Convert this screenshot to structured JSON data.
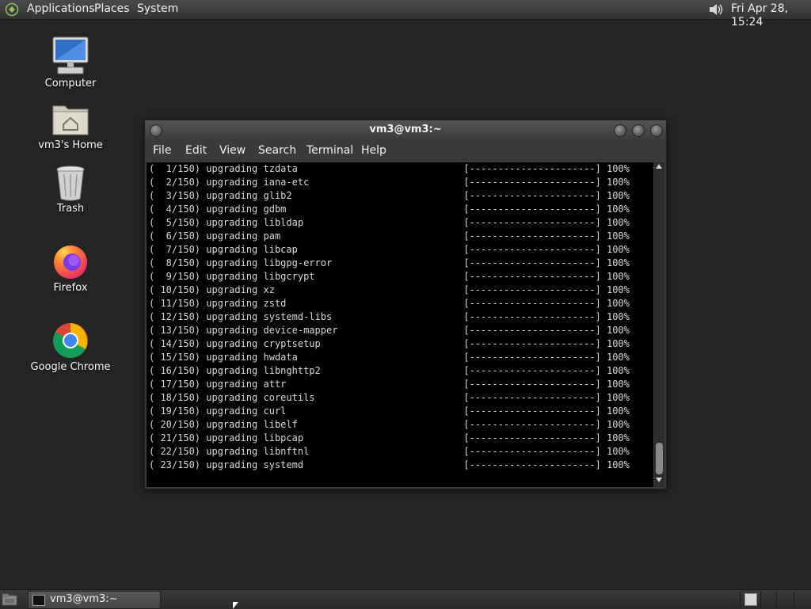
{
  "top_panel": {
    "menus": [
      "Applications",
      "Places",
      "System"
    ],
    "clock": "Fri Apr 28, 15:24"
  },
  "desktop_icons": [
    {
      "label": "Computer",
      "icon": "computer-icon"
    },
    {
      "label": "vm3's Home",
      "icon": "home-folder-icon"
    },
    {
      "label": "Trash",
      "icon": "trash-icon"
    },
    {
      "label": "Firefox",
      "icon": "firefox-icon"
    },
    {
      "label": "Google Chrome",
      "icon": "chrome-icon"
    }
  ],
  "terminal": {
    "title": "vm3@vm3:~",
    "menu": [
      "File",
      "Edit",
      "View",
      "Search",
      "Terminal",
      "Help"
    ],
    "lines": [
      "(  1/150) upgrading tzdata                             [----------------------] 100%",
      "(  2/150) upgrading iana-etc                           [----------------------] 100%",
      "(  3/150) upgrading glib2                              [----------------------] 100%",
      "(  4/150) upgrading gdbm                               [----------------------] 100%",
      "(  5/150) upgrading libldap                            [----------------------] 100%",
      "(  6/150) upgrading pam                                [----------------------] 100%",
      "(  7/150) upgrading libcap                             [----------------------] 100%",
      "(  8/150) upgrading libgpg-error                       [----------------------] 100%",
      "(  9/150) upgrading libgcrypt                          [----------------------] 100%",
      "( 10/150) upgrading xz                                 [----------------------] 100%",
      "( 11/150) upgrading zstd                               [----------------------] 100%",
      "( 12/150) upgrading systemd-libs                       [----------------------] 100%",
      "( 13/150) upgrading device-mapper                      [----------------------] 100%",
      "( 14/150) upgrading cryptsetup                         [----------------------] 100%",
      "( 15/150) upgrading hwdata                             [----------------------] 100%",
      "( 16/150) upgrading libnghttp2                         [----------------------] 100%",
      "( 17/150) upgrading attr                               [----------------------] 100%",
      "( 18/150) upgrading coreutils                          [----------------------] 100%",
      "( 19/150) upgrading curl                               [----------------------] 100%",
      "( 20/150) upgrading libelf                             [----------------------] 100%",
      "( 21/150) upgrading libpcap                            [----------------------] 100%",
      "( 22/150) upgrading libnftnl                           [----------------------] 100%",
      "( 23/150) upgrading systemd                            [----------------------] 100%"
    ]
  },
  "taskbar": {
    "task_label": "vm3@vm3:~"
  },
  "colors": {
    "desktop_bg": "#252525",
    "panel_bg": "#3a3a3a",
    "terminal_bg": "#000000",
    "terminal_fg": "#d8d8d8"
  }
}
